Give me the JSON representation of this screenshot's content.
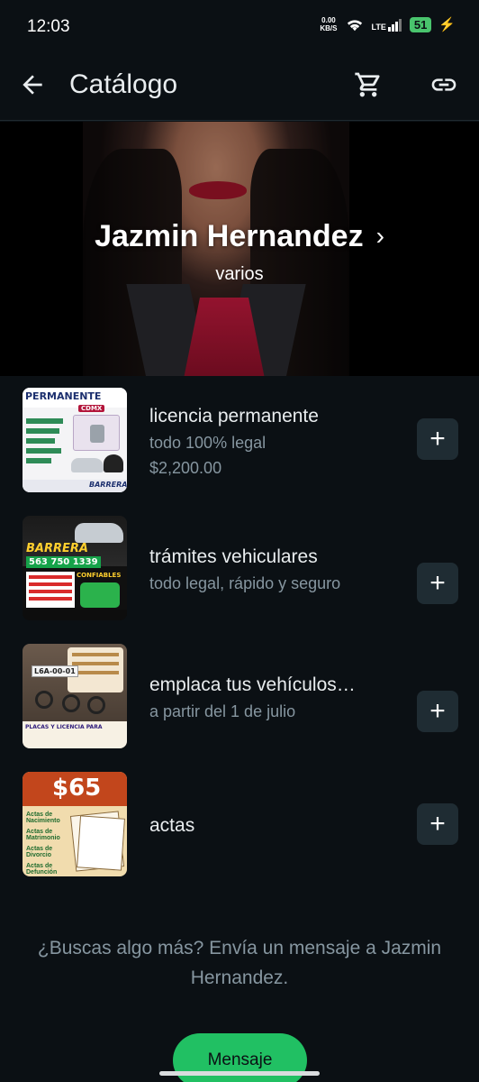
{
  "status_bar": {
    "time": "12:03",
    "net_speed_value": "0.00",
    "net_speed_unit": "KB/S",
    "network": "LTE",
    "battery": "51"
  },
  "app_bar": {
    "title": "Catálogo",
    "icons": [
      "arrow-back-icon",
      "cart-icon",
      "link-icon"
    ]
  },
  "business": {
    "name": "Jazmin Hernandez",
    "description": "varios"
  },
  "products": [
    {
      "name": "licencia permanente",
      "subtitle": "todo 100% legal",
      "price": "$2,200.00",
      "thumb": {
        "banner": "PERMANENTE",
        "badge": "CDMX",
        "signature": "BARRERA"
      }
    },
    {
      "name": "trámites vehiculares",
      "subtitle": "todo legal, rápido y seguro",
      "price": "",
      "thumb": {
        "banner": "BARRERA",
        "phone": "563 750 1339",
        "tag": "CONFIABLES"
      }
    },
    {
      "name": "emplaca tus vehículos…",
      "subtitle": "a partir del 1 de julio",
      "price": "",
      "thumb": {
        "plate": "L6A-00-01",
        "banner": "PLACAS Y LICENCIA PARA"
      }
    },
    {
      "name": "actas",
      "subtitle": "",
      "price": "",
      "thumb": {
        "price": "$65",
        "lines": [
          "Actas de Nacimiento",
          "Actas de Matrimonio",
          "Actas de Divorcio",
          "Actas de Defunción"
        ]
      }
    }
  ],
  "footer": {
    "message": "¿Buscas algo más? Envía un mensaje a Jazmin Hernandez.",
    "button_label": "Mensaje"
  },
  "colors": {
    "background": "#0b1014",
    "accent": "#21c063",
    "secondary_text": "#8696a0"
  }
}
